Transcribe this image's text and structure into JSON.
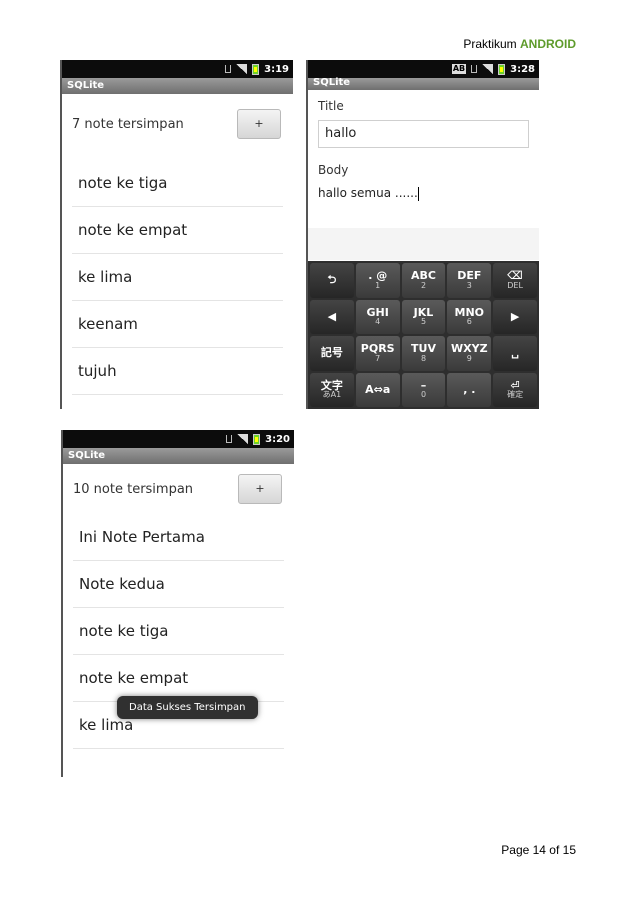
{
  "page": {
    "header_prefix": "Praktikum",
    "header_brand": "ANDROID",
    "footer": "Page 14 of 15"
  },
  "screen1": {
    "time": "3:19",
    "app_title": "SQLite",
    "count_text": "7 note tersimpan",
    "add_label": "+",
    "items": [
      "note ke tiga",
      "note ke empat",
      "ke lima",
      "keenam",
      "tujuh"
    ]
  },
  "screen2": {
    "time": "3:28",
    "ime_badge": "AB",
    "app_title": "SQLite",
    "title_label": "Title",
    "title_value": "hallo",
    "body_label": "Body",
    "body_value": "hallo semua ......",
    "keys": [
      {
        "main": "⮌",
        "sub": ""
      },
      {
        "main": ". @",
        "sub": "1"
      },
      {
        "main": "ABC",
        "sub": "2"
      },
      {
        "main": "DEF",
        "sub": "3"
      },
      {
        "main": "⌫",
        "sub": "DEL"
      },
      {
        "main": "◀",
        "sub": ""
      },
      {
        "main": "GHI",
        "sub": "4"
      },
      {
        "main": "JKL",
        "sub": "5"
      },
      {
        "main": "MNO",
        "sub": "6"
      },
      {
        "main": "▶",
        "sub": ""
      },
      {
        "main": "記号",
        "sub": ""
      },
      {
        "main": "PQRS",
        "sub": "7"
      },
      {
        "main": "TUV",
        "sub": "8"
      },
      {
        "main": "WXYZ",
        "sub": "9"
      },
      {
        "main": "␣",
        "sub": ""
      },
      {
        "main": "文字",
        "sub": "あA1"
      },
      {
        "main": "A⇔a",
        "sub": ""
      },
      {
        "main": "–",
        "sub": "0"
      },
      {
        "main": ", .",
        "sub": ""
      },
      {
        "main": "⏎",
        "sub": "確定"
      }
    ]
  },
  "screen3": {
    "time": "3:20",
    "app_title": "SQLite",
    "count_text": "10 note tersimpan",
    "add_label": "+",
    "items": [
      "Ini Note Pertama",
      "Note kedua",
      "note ke tiga",
      "note ke empat",
      "ke lima"
    ],
    "toast": "Data Sukses Tersimpan"
  }
}
